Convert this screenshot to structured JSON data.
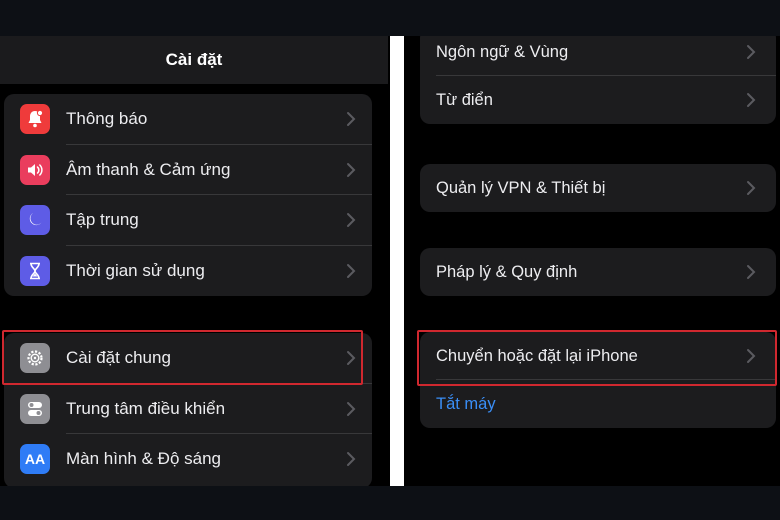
{
  "left_panel": {
    "title": "Cài đặt",
    "group1": [
      {
        "label": "Thông báo",
        "icon": "bell-icon",
        "color": "#ef3b3b"
      },
      {
        "label": "Âm thanh & Cảm ứng",
        "icon": "speaker-icon",
        "color": "#ea3d5d"
      },
      {
        "label": "Tập trung",
        "icon": "moon-icon",
        "color": "#5e5ce6"
      },
      {
        "label": "Thời gian sử dụng",
        "icon": "hourglass-icon",
        "color": "#5e5ce6"
      }
    ],
    "group2": [
      {
        "label": "Cài đặt chung",
        "icon": "gear-icon",
        "color": "#8e8e93"
      },
      {
        "label": "Trung tâm điều khiển",
        "icon": "toggles-icon",
        "color": "#8e8e93"
      },
      {
        "label": "Màn hình & Độ sáng",
        "icon": "text-size-icon",
        "color": "#2f7cf6",
        "icon_text": "AA"
      }
    ]
  },
  "right_panel": {
    "group1": [
      {
        "label": "Ngôn ngữ & Vùng"
      },
      {
        "label": "Từ điển"
      }
    ],
    "group2": [
      {
        "label": "Quản lý VPN & Thiết bị"
      }
    ],
    "group3": [
      {
        "label": "Pháp lý & Quy định"
      }
    ],
    "group4": [
      {
        "label": "Chuyển hoặc đặt lại iPhone"
      },
      {
        "label": "Tắt máy"
      }
    ]
  },
  "colors": {
    "highlight": "#d0282f",
    "link": "#3a8ef6",
    "cell_bg": "#1c1c1e"
  }
}
